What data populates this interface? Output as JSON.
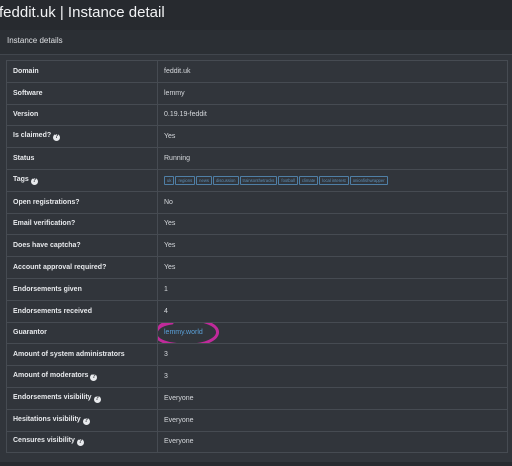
{
  "header": {
    "title": "feddit.uk | Instance detail"
  },
  "card": {
    "title": "Instance details"
  },
  "colors": {
    "green": "#3d9a5e",
    "link": "#5aa0d8",
    "annotation": "#c02a9a"
  },
  "rows": [
    {
      "label": "Domain",
      "value": "feddit.uk"
    },
    {
      "label": "Software",
      "value": "lemmy"
    },
    {
      "label": "Version",
      "value": "0.19.19-feddit"
    },
    {
      "label": "Is claimed?",
      "value": "Yes",
      "help": true
    },
    {
      "label": "Status",
      "value": "Running"
    },
    {
      "label": "Tags",
      "help": true
    },
    {
      "label": "Open registrations?",
      "value": "No"
    },
    {
      "label": "Email verification?",
      "value": "Yes"
    },
    {
      "label": "Does have captcha?",
      "value": "Yes"
    },
    {
      "label": "Account approval required?",
      "value": "Yes"
    },
    {
      "label": "Endorsements given",
      "value": "1"
    },
    {
      "label": "Endorsements received",
      "value": "4"
    },
    {
      "label": "Guarantor",
      "value": "lemmy.world"
    },
    {
      "label": "Amount of system administrators",
      "value": "3"
    },
    {
      "label": "Amount of moderators",
      "value": "3",
      "help": true
    },
    {
      "label": "Endorsements visibility",
      "value": "Everyone",
      "help": true
    },
    {
      "label": "Hesitations visibility",
      "value": "Everyone",
      "help": true
    },
    {
      "label": "Censures visibility",
      "value": "Everyone",
      "help": true
    }
  ],
  "tags": [
    "uk",
    "regions",
    "news",
    "discussion",
    "trainsonthetracks",
    "football",
    "climate",
    "local interest",
    "onionfishwrapper"
  ],
  "help_icon_glyph": "?"
}
